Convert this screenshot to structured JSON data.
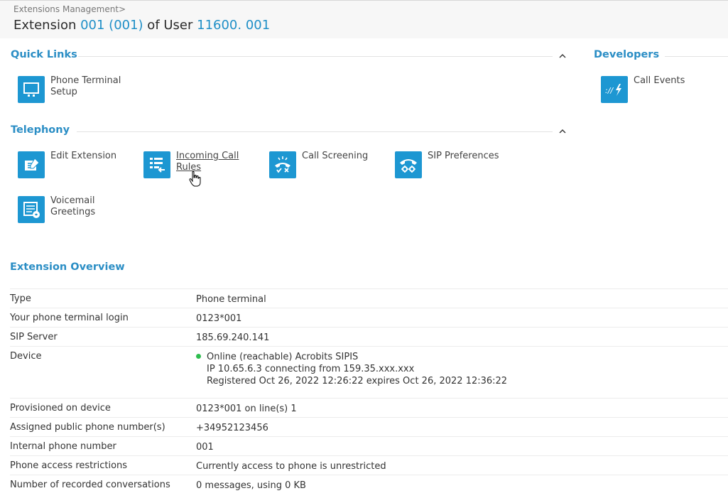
{
  "breadcrumb": "Extensions Management>",
  "title": {
    "prefix": "Extension ",
    "extension": "001 (001)",
    "middle": " of User ",
    "user": "11600. 001"
  },
  "quick_links": {
    "title": "Quick Links",
    "items": [
      {
        "label": "Phone Terminal Setup",
        "icon": "monitor-icon"
      }
    ]
  },
  "developers": {
    "title": "Developers",
    "items": [
      {
        "label": "Call Events",
        "icon": "call-events-icon"
      }
    ]
  },
  "telephony": {
    "title": "Telephony",
    "items": [
      {
        "label": "Edit Extension",
        "icon": "edit-extension-icon"
      },
      {
        "label": "Incoming Call Rules",
        "icon": "incoming-rules-icon"
      },
      {
        "label": "Call Screening",
        "icon": "call-screening-icon"
      },
      {
        "label": "SIP Preferences",
        "icon": "sip-preferences-icon"
      },
      {
        "label": "Voicemail Greetings",
        "icon": "voicemail-icon"
      }
    ]
  },
  "overview": {
    "title": "Extension Overview",
    "rows": [
      {
        "key": "Type",
        "value": "Phone terminal"
      },
      {
        "key": "Your phone terminal login",
        "value": "0123*001"
      },
      {
        "key": "SIP Server",
        "value": "185.69.240.141"
      },
      {
        "key": "Device",
        "status": "Online (reachable) Acrobits SIPIS",
        "status_color": "#2ebd4f",
        "line2": "IP 10.65.6.3 connecting from 159.35.xxx.xxx",
        "line3": "Registered Oct 26, 2022 12:26:22 expires Oct 26, 2022 12:36:22"
      },
      {
        "key": "Provisioned on device",
        "value": "0123*001 on line(s) 1"
      },
      {
        "key": "Assigned public phone number(s)",
        "value": "+34952123456"
      },
      {
        "key": "Internal phone number",
        "value": "001"
      },
      {
        "key": "Phone access restrictions",
        "value": "Currently access to phone is unrestricted"
      },
      {
        "key": "Number of recorded conversations",
        "value": "0 messages, using 0 KB"
      }
    ]
  },
  "colors": {
    "accent": "#1d97d2",
    "heading": "#2b8ec5",
    "online": "#2ebd4f"
  }
}
